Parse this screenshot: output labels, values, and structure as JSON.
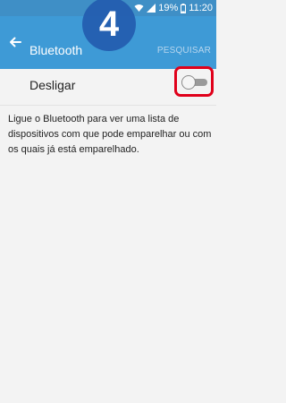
{
  "status_bar": {
    "battery_percent": "19%",
    "time": "11:20"
  },
  "app_bar": {
    "title": "Bluetooth",
    "search_label": "PESQUISAR"
  },
  "step_badge": "4",
  "toggle": {
    "label": "Desligar",
    "state": "off"
  },
  "info_text": "Ligue o Bluetooth para ver uma lista de dispositivos com que pode emparelhar ou com os quais já está emparelhado.",
  "colors": {
    "status_bar": "#3f8fc6",
    "app_bar": "#3e9ad6",
    "highlight": "#e0001a"
  }
}
